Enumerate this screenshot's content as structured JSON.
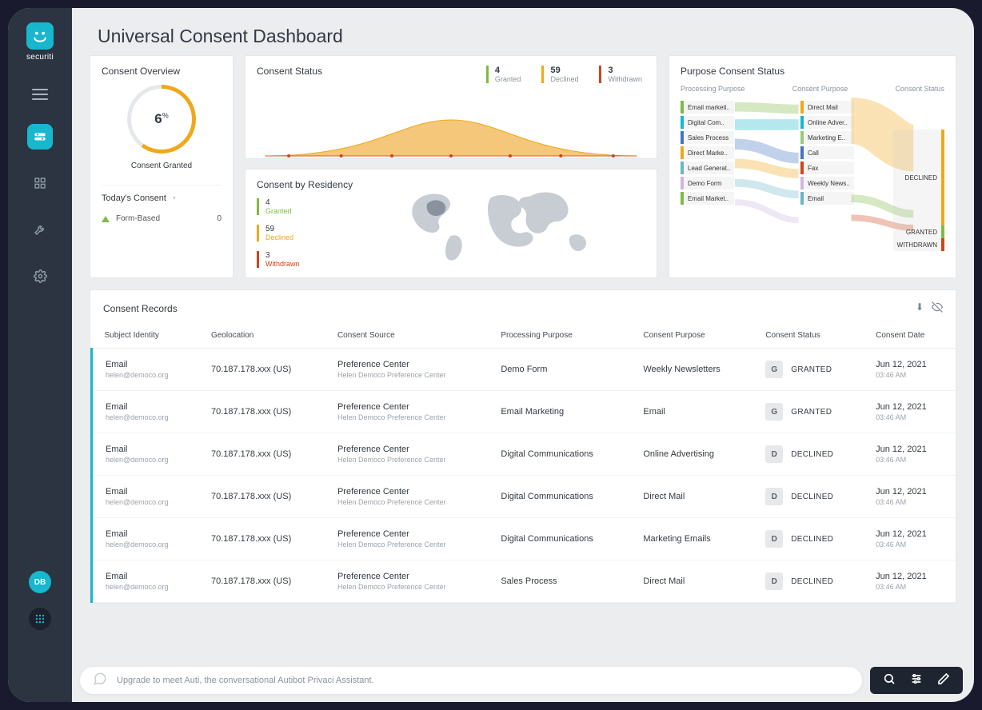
{
  "brand": {
    "name": "securiti",
    "avatar": "DB"
  },
  "page_title": "Universal Consent Dashboard",
  "overview": {
    "title": "Consent Overview",
    "gauge_value": "6",
    "gauge_unit": "%",
    "gauge_label": "Consent Granted",
    "today_title": "Today's Consent",
    "form_based_label": "Form-Based",
    "form_based_value": "0"
  },
  "status": {
    "title": "Consent Status",
    "granted_num": "4",
    "granted_label": "Granted",
    "declined_num": "59",
    "declined_label": "Declined",
    "withdrawn_num": "3",
    "withdrawn_label": "Withdrawn"
  },
  "residency": {
    "title": "Consent by Residency",
    "granted_num": "4",
    "granted_label": "Granted",
    "declined_num": "59",
    "declined_label": "Declined",
    "withdrawn_num": "3",
    "withdrawn_label": "Withdrawn"
  },
  "sankey": {
    "title": "Purpose Consent Status",
    "col1": "Processing Purpose",
    "col2": "Consent Purpose",
    "col3": "Consent Status",
    "left": [
      {
        "label": "Email marketi..",
        "color": "#7fba44"
      },
      {
        "label": "Digital Com..",
        "color": "#18b7cd"
      },
      {
        "label": "Sales Process",
        "color": "#4474c4"
      },
      {
        "label": "Direct Marke..",
        "color": "#f0a81b"
      },
      {
        "label": "Lead Generat..",
        "color": "#6bb5c9"
      },
      {
        "label": "Demo Form",
        "color": "#cdb6e0"
      },
      {
        "label": "Email Market..",
        "color": "#7fba44"
      }
    ],
    "mid": [
      {
        "label": "Direct Mail",
        "color": "#f0a81b"
      },
      {
        "label": "Online Adver..",
        "color": "#18b7cd"
      },
      {
        "label": "Marketing E..",
        "color": "#9ac97a"
      },
      {
        "label": "Call",
        "color": "#4474c4"
      },
      {
        "label": "Fax",
        "color": "#d0451b"
      },
      {
        "label": "Weekly News..",
        "color": "#cdb6e0"
      },
      {
        "label": "Email",
        "color": "#6bb5c9"
      }
    ],
    "right": [
      {
        "label": "DECLINED",
        "color": "#f0a81b"
      },
      {
        "label": "GRANTED",
        "color": "#7fba44"
      },
      {
        "label": "WITHDRAWN",
        "color": "#d0451b"
      }
    ]
  },
  "records": {
    "title": "Consent Records",
    "columns": [
      "Subject Identity",
      "Geolocation",
      "Consent Source",
      "Processing Purpose",
      "Consent Purpose",
      "Consent Status",
      "Consent Date"
    ],
    "rows": [
      {
        "id_main": "Email",
        "id_sub": "helen@democo.org",
        "geo": "70.187.178.xxx (US)",
        "src_main": "Preference Center",
        "src_sub": "Helen Democo Preference Center",
        "purpose": "Demo Form",
        "consent_purpose": "Weekly Newsletters",
        "status_letter": "G",
        "status_text": "GRANTED",
        "date_main": "Jun 12, 2021",
        "date_sub": "03:46 AM"
      },
      {
        "id_main": "Email",
        "id_sub": "helen@democo.org",
        "geo": "70.187.178.xxx (US)",
        "src_main": "Preference Center",
        "src_sub": "Helen Democo Preference Center",
        "purpose": "Email Marketing",
        "consent_purpose": "Email",
        "status_letter": "G",
        "status_text": "GRANTED",
        "date_main": "Jun 12, 2021",
        "date_sub": "03:46 AM"
      },
      {
        "id_main": "Email",
        "id_sub": "helen@democo.org",
        "geo": "70.187.178.xxx (US)",
        "src_main": "Preference Center",
        "src_sub": "Helen Democo Preference Center",
        "purpose": "Digital Communications",
        "consent_purpose": "Online Advertising",
        "status_letter": "D",
        "status_text": "DECLINED",
        "date_main": "Jun 12, 2021",
        "date_sub": "03:46 AM"
      },
      {
        "id_main": "Email",
        "id_sub": "helen@democo.org",
        "geo": "70.187.178.xxx (US)",
        "src_main": "Preference Center",
        "src_sub": "Helen Democo Preference Center",
        "purpose": "Digital Communications",
        "consent_purpose": "Direct Mail",
        "status_letter": "D",
        "status_text": "DECLINED",
        "date_main": "Jun 12, 2021",
        "date_sub": "03:46 AM"
      },
      {
        "id_main": "Email",
        "id_sub": "helen@democo.org",
        "geo": "70.187.178.xxx (US)",
        "src_main": "Preference Center",
        "src_sub": "Helen Democo Preference Center",
        "purpose": "Digital Communications",
        "consent_purpose": "Marketing Emails",
        "status_letter": "D",
        "status_text": "DECLINED",
        "date_main": "Jun 12, 2021",
        "date_sub": "03:46 AM"
      },
      {
        "id_main": "Email",
        "id_sub": "helen@democo.org",
        "geo": "70.187.178.xxx (US)",
        "src_main": "Preference Center",
        "src_sub": "Helen Democo Preference Center",
        "purpose": "Sales Process",
        "consent_purpose": "Direct Mail",
        "status_letter": "D",
        "status_text": "DECLINED",
        "date_main": "Jun 12, 2021",
        "date_sub": "03:46 AM"
      }
    ]
  },
  "footer": {
    "text": "Upgrade to meet Auti, the conversational Autibot Privaci Assistant."
  }
}
